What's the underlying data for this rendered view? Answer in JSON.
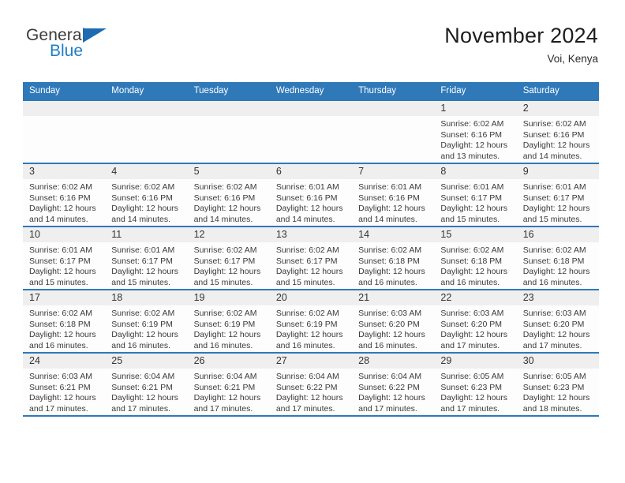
{
  "brand": {
    "name_part1": "General",
    "name_part2": "Blue",
    "accent_color": "#1f7ec4",
    "triangle_color": "#1d6cb1"
  },
  "header": {
    "title": "November 2024",
    "subtitle": "Voi, Kenya"
  },
  "calendar": {
    "header_bg": "#2f79b9",
    "daynum_bg": "#efefef",
    "weekday_labels": [
      "Sunday",
      "Monday",
      "Tuesday",
      "Wednesday",
      "Thursday",
      "Friday",
      "Saturday"
    ],
    "weeks": [
      [
        {
          "day": "",
          "empty": true
        },
        {
          "day": "",
          "empty": true
        },
        {
          "day": "",
          "empty": true
        },
        {
          "day": "",
          "empty": true
        },
        {
          "day": "",
          "empty": true
        },
        {
          "day": "1",
          "sunrise": "Sunrise: 6:02 AM",
          "sunset": "Sunset: 6:16 PM",
          "daylight": "Daylight: 12 hours and 13 minutes."
        },
        {
          "day": "2",
          "sunrise": "Sunrise: 6:02 AM",
          "sunset": "Sunset: 6:16 PM",
          "daylight": "Daylight: 12 hours and 14 minutes."
        }
      ],
      [
        {
          "day": "3",
          "sunrise": "Sunrise: 6:02 AM",
          "sunset": "Sunset: 6:16 PM",
          "daylight": "Daylight: 12 hours and 14 minutes."
        },
        {
          "day": "4",
          "sunrise": "Sunrise: 6:02 AM",
          "sunset": "Sunset: 6:16 PM",
          "daylight": "Daylight: 12 hours and 14 minutes."
        },
        {
          "day": "5",
          "sunrise": "Sunrise: 6:02 AM",
          "sunset": "Sunset: 6:16 PM",
          "daylight": "Daylight: 12 hours and 14 minutes."
        },
        {
          "day": "6",
          "sunrise": "Sunrise: 6:01 AM",
          "sunset": "Sunset: 6:16 PM",
          "daylight": "Daylight: 12 hours and 14 minutes."
        },
        {
          "day": "7",
          "sunrise": "Sunrise: 6:01 AM",
          "sunset": "Sunset: 6:16 PM",
          "daylight": "Daylight: 12 hours and 14 minutes."
        },
        {
          "day": "8",
          "sunrise": "Sunrise: 6:01 AM",
          "sunset": "Sunset: 6:17 PM",
          "daylight": "Daylight: 12 hours and 15 minutes."
        },
        {
          "day": "9",
          "sunrise": "Sunrise: 6:01 AM",
          "sunset": "Sunset: 6:17 PM",
          "daylight": "Daylight: 12 hours and 15 minutes."
        }
      ],
      [
        {
          "day": "10",
          "sunrise": "Sunrise: 6:01 AM",
          "sunset": "Sunset: 6:17 PM",
          "daylight": "Daylight: 12 hours and 15 minutes."
        },
        {
          "day": "11",
          "sunrise": "Sunrise: 6:01 AM",
          "sunset": "Sunset: 6:17 PM",
          "daylight": "Daylight: 12 hours and 15 minutes."
        },
        {
          "day": "12",
          "sunrise": "Sunrise: 6:02 AM",
          "sunset": "Sunset: 6:17 PM",
          "daylight": "Daylight: 12 hours and 15 minutes."
        },
        {
          "day": "13",
          "sunrise": "Sunrise: 6:02 AM",
          "sunset": "Sunset: 6:17 PM",
          "daylight": "Daylight: 12 hours and 15 minutes."
        },
        {
          "day": "14",
          "sunrise": "Sunrise: 6:02 AM",
          "sunset": "Sunset: 6:18 PM",
          "daylight": "Daylight: 12 hours and 16 minutes."
        },
        {
          "day": "15",
          "sunrise": "Sunrise: 6:02 AM",
          "sunset": "Sunset: 6:18 PM",
          "daylight": "Daylight: 12 hours and 16 minutes."
        },
        {
          "day": "16",
          "sunrise": "Sunrise: 6:02 AM",
          "sunset": "Sunset: 6:18 PM",
          "daylight": "Daylight: 12 hours and 16 minutes."
        }
      ],
      [
        {
          "day": "17",
          "sunrise": "Sunrise: 6:02 AM",
          "sunset": "Sunset: 6:18 PM",
          "daylight": "Daylight: 12 hours and 16 minutes."
        },
        {
          "day": "18",
          "sunrise": "Sunrise: 6:02 AM",
          "sunset": "Sunset: 6:19 PM",
          "daylight": "Daylight: 12 hours and 16 minutes."
        },
        {
          "day": "19",
          "sunrise": "Sunrise: 6:02 AM",
          "sunset": "Sunset: 6:19 PM",
          "daylight": "Daylight: 12 hours and 16 minutes."
        },
        {
          "day": "20",
          "sunrise": "Sunrise: 6:02 AM",
          "sunset": "Sunset: 6:19 PM",
          "daylight": "Daylight: 12 hours and 16 minutes."
        },
        {
          "day": "21",
          "sunrise": "Sunrise: 6:03 AM",
          "sunset": "Sunset: 6:20 PM",
          "daylight": "Daylight: 12 hours and 16 minutes."
        },
        {
          "day": "22",
          "sunrise": "Sunrise: 6:03 AM",
          "sunset": "Sunset: 6:20 PM",
          "daylight": "Daylight: 12 hours and 17 minutes."
        },
        {
          "day": "23",
          "sunrise": "Sunrise: 6:03 AM",
          "sunset": "Sunset: 6:20 PM",
          "daylight": "Daylight: 12 hours and 17 minutes."
        }
      ],
      [
        {
          "day": "24",
          "sunrise": "Sunrise: 6:03 AM",
          "sunset": "Sunset: 6:21 PM",
          "daylight": "Daylight: 12 hours and 17 minutes."
        },
        {
          "day": "25",
          "sunrise": "Sunrise: 6:04 AM",
          "sunset": "Sunset: 6:21 PM",
          "daylight": "Daylight: 12 hours and 17 minutes."
        },
        {
          "day": "26",
          "sunrise": "Sunrise: 6:04 AM",
          "sunset": "Sunset: 6:21 PM",
          "daylight": "Daylight: 12 hours and 17 minutes."
        },
        {
          "day": "27",
          "sunrise": "Sunrise: 6:04 AM",
          "sunset": "Sunset: 6:22 PM",
          "daylight": "Daylight: 12 hours and 17 minutes."
        },
        {
          "day": "28",
          "sunrise": "Sunrise: 6:04 AM",
          "sunset": "Sunset: 6:22 PM",
          "daylight": "Daylight: 12 hours and 17 minutes."
        },
        {
          "day": "29",
          "sunrise": "Sunrise: 6:05 AM",
          "sunset": "Sunset: 6:23 PM",
          "daylight": "Daylight: 12 hours and 17 minutes."
        },
        {
          "day": "30",
          "sunrise": "Sunrise: 6:05 AM",
          "sunset": "Sunset: 6:23 PM",
          "daylight": "Daylight: 12 hours and 18 minutes."
        }
      ]
    ]
  }
}
